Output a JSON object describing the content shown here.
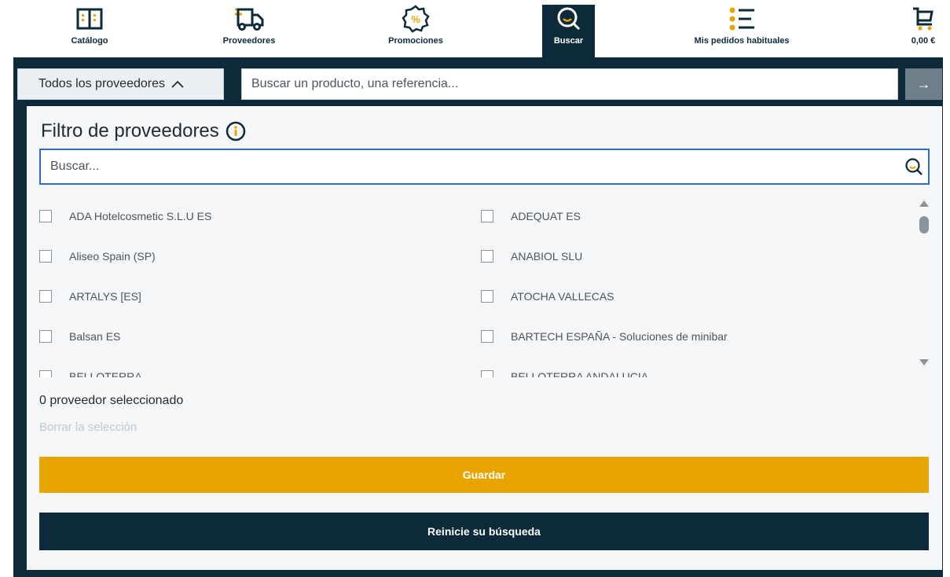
{
  "nav": {
    "items": [
      {
        "label": "Catálogo",
        "icon": "catalog-book-icon"
      },
      {
        "label": "Proveedores",
        "icon": "delivery-truck-icon"
      },
      {
        "label": "Promociones",
        "icon": "percent-badge-icon"
      },
      {
        "label": "Buscar",
        "icon": "search-icon",
        "active": true
      },
      {
        "label": "Mis pedidos habituales",
        "icon": "list-icon"
      },
      {
        "label": "0,00 €",
        "icon": "cart-icon"
      }
    ]
  },
  "search": {
    "supplier_toggle_label": "Todos los proveedores",
    "placeholder": "Buscar un producto, una referencia...",
    "go_symbol": "→"
  },
  "filter": {
    "title": "Filtro de proveedores",
    "search_placeholder": "Buscar...",
    "suppliers": [
      "ADA Hotelcosmetic S.L.U ES",
      "ADEQUAT ES",
      "Aliseo Spain (SP)",
      "ANABIOL SLU",
      "ARTALYS [ES]",
      "ATOCHA VALLECAS",
      "Balsan ES",
      "BARTECH ESPAÑA - Soluciones de minibar",
      "BELLOTERRA",
      "BELLOTERRA ANDALUCIA"
    ],
    "selected_count": "0 proveedor seleccionado",
    "clear_label": "Borrar la selección",
    "save_label": "Guardar",
    "reset_label": "Reinicie su búsqueda"
  },
  "colors": {
    "navy": "#0d2a3b",
    "accent": "#e8a400",
    "focus": "#2e6bd1"
  }
}
